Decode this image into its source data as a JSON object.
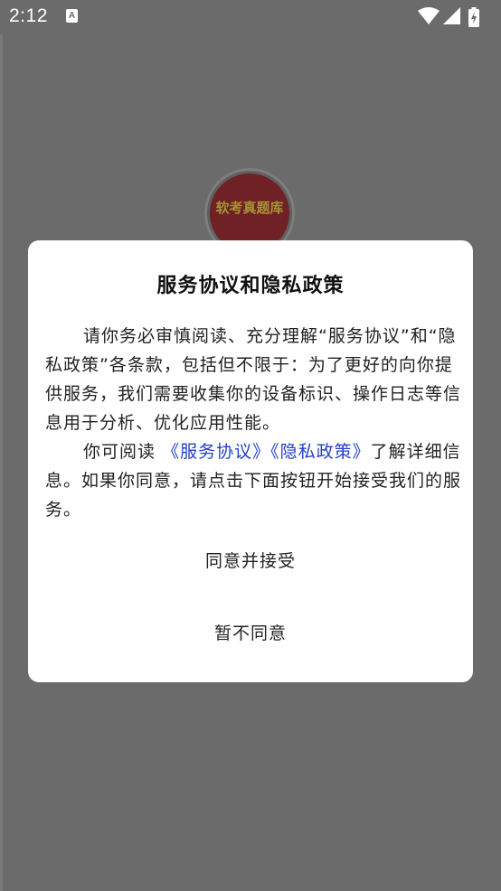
{
  "status_bar": {
    "time": "2:12",
    "notification_icon": "a-icon",
    "icons": [
      "wifi-icon",
      "signal-icon",
      "battery-charging-icon"
    ]
  },
  "background": {
    "logo_text": "软考真题库"
  },
  "dialog": {
    "title": "服务协议和隐私政策",
    "para1": "请你务必审慎阅读、充分理解“服务协议”和“隐私政策”各条款，包括但不限于：为了更好的向你提供服务，我们需要收集你的设备标识、操作日志等信息用于分析、优化应用性能。",
    "para2_prefix": "你可阅读",
    "link_service": "《服务协议》",
    "link_privacy": "《隐私政策》",
    "para2_suffix": "了解详细信息。如果你同意，请点击下面按钮开始接受我们的服务。",
    "agree_label": "同意并接受",
    "decline_label": "暂不同意"
  },
  "colors": {
    "overlay": "#6b6b6b",
    "link": "#2340c8",
    "dialog_bg": "#ffffff"
  }
}
